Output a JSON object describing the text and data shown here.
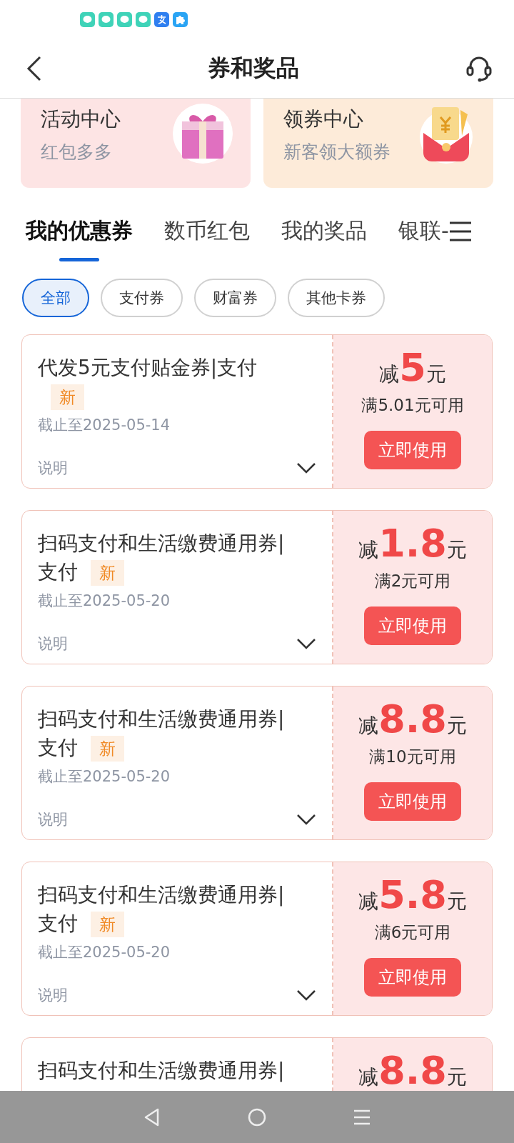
{
  "status_bar": {
    "notification_icons": [
      {
        "kind": "chat"
      },
      {
        "kind": "chat"
      },
      {
        "kind": "chat"
      },
      {
        "kind": "chat"
      },
      {
        "kind": "pay"
      },
      {
        "kind": "puzzle"
      }
    ]
  },
  "header": {
    "title": "券和奖品"
  },
  "promo_cards": [
    {
      "title": "活动中心",
      "subtitle": "红包多多",
      "kind": "gift"
    },
    {
      "title": "领券中心",
      "subtitle": "新客领大额券",
      "kind": "envelope"
    }
  ],
  "tabs": [
    {
      "label": "我的优惠券",
      "selected": true
    },
    {
      "label": "数币红包",
      "selected": false
    },
    {
      "label": "我的奖品",
      "selected": false
    },
    {
      "label": "银联-",
      "selected": false
    }
  ],
  "filters": [
    {
      "label": "全部",
      "selected": true
    },
    {
      "label": "支付券",
      "selected": false
    },
    {
      "label": "财富券",
      "selected": false
    },
    {
      "label": "其他卡券",
      "selected": false
    }
  ],
  "coupons": [
    {
      "title": "代发5元支付贴金券|支付",
      "badge": "新",
      "expiry": "截止至2025-05-14",
      "note": "说明",
      "prefix": "减",
      "amount": "5",
      "unit": "元",
      "condition": "满5.01元可用",
      "button": "立即使用"
    },
    {
      "title": "扫码支付和生活缴费通用券|支付",
      "badge": "新",
      "expiry": "截止至2025-05-20",
      "note": "说明",
      "prefix": "减",
      "amount": "1.8",
      "unit": "元",
      "condition": "满2元可用",
      "button": "立即使用"
    },
    {
      "title": "扫码支付和生活缴费通用券|支付",
      "badge": "新",
      "expiry": "截止至2025-05-20",
      "note": "说明",
      "prefix": "减",
      "amount": "8.8",
      "unit": "元",
      "condition": "满10元可用",
      "button": "立即使用"
    },
    {
      "title": "扫码支付和生活缴费通用券|支付",
      "badge": "新",
      "expiry": "截止至2025-05-20",
      "note": "说明",
      "prefix": "减",
      "amount": "5.8",
      "unit": "元",
      "condition": "满6元可用",
      "button": "立即使用"
    },
    {
      "title": "扫码支付和生活缴费通用券|",
      "prefix": "减",
      "amount": "8.8",
      "unit": "元"
    }
  ]
}
